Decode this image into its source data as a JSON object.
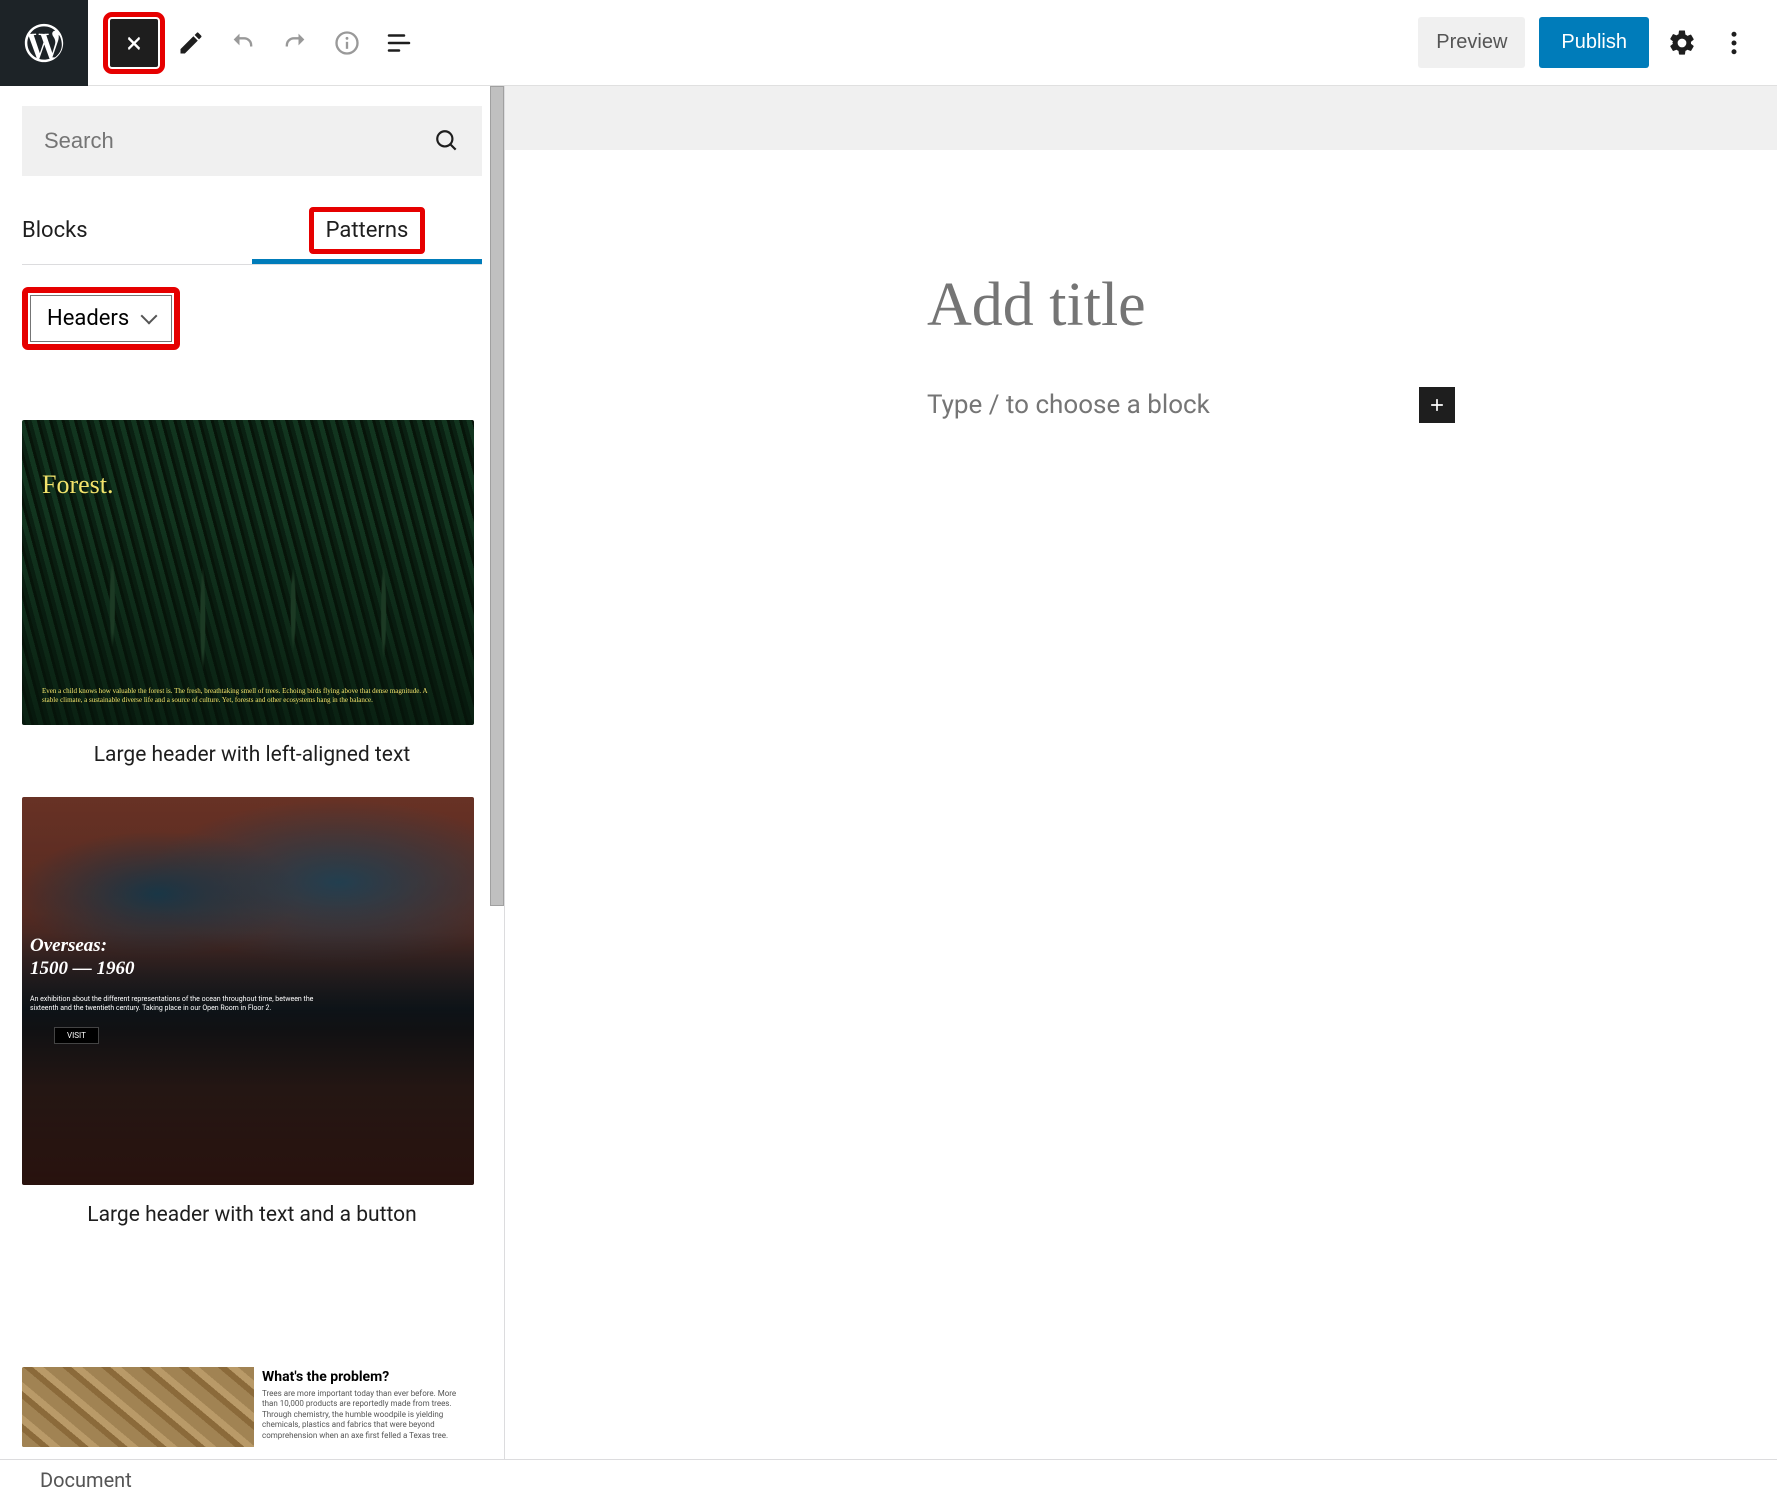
{
  "topbar": {
    "preview_label": "Preview",
    "publish_label": "Publish"
  },
  "inserter": {
    "search_placeholder": "Search",
    "tabs": {
      "blocks": "Blocks",
      "patterns": "Patterns"
    },
    "category_selected": "Headers",
    "patterns": [
      {
        "caption": "Large header with left-aligned text",
        "title": "Forest.",
        "tiny_text": "Even a child knows how valuable the forest is. The fresh, breathtaking smell of trees. Echoing birds flying above that dense magnitude. A stable climate, a sustainable diverse life and a source of culture. Yet, forests and other ecosystems hang in the balance."
      },
      {
        "caption": "Large header with text and a button",
        "title": "Overseas:\n1500 — 1960",
        "tiny_text": "An exhibition about the different representations of the ocean throughout time, between the sixteenth and the twentieth century. Taking place in our Open Room in Floor 2.",
        "button_label": "VISIT"
      },
      {
        "caption": "",
        "title": "What's the problem?",
        "tiny_text": "Trees are more important today than ever before. More than 10,000 products are reportedly made from trees. Through chemistry, the humble woodpile is yielding chemicals, plastics and fabrics that were beyond comprehension when an axe first felled a Texas tree."
      }
    ]
  },
  "editor": {
    "title_placeholder": "Add title",
    "block_placeholder": "Type / to choose a block"
  },
  "footer": {
    "breadcrumb": "Document"
  },
  "colors": {
    "accent": "#007cba",
    "highlight": "#e60000",
    "toolbar_dark": "#1e1e1e"
  }
}
